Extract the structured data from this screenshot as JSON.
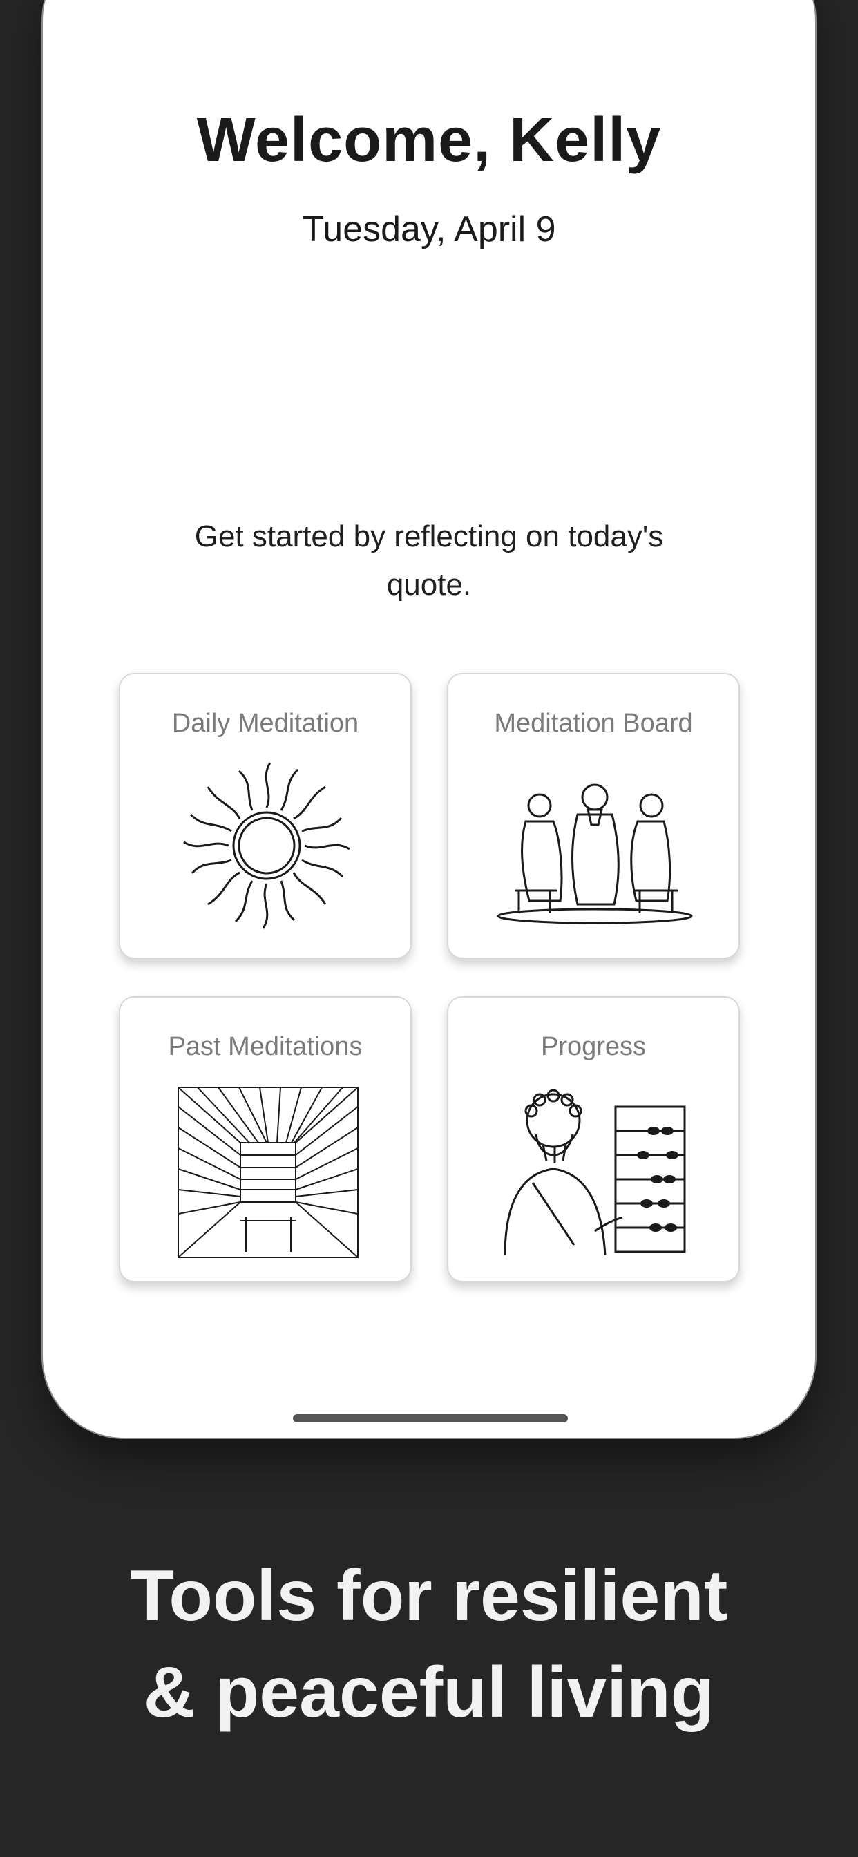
{
  "screen": {
    "greeting": "Welcome, Kelly",
    "date": "Tuesday, April 9",
    "prompt": "Get started by reflecting on today's quote."
  },
  "cards": [
    {
      "label": "Daily Meditation",
      "icon": "sun-illustration"
    },
    {
      "label": "Meditation Board",
      "icon": "three-philosophers-illustration"
    },
    {
      "label": "Past Meditations",
      "icon": "library-illustration"
    },
    {
      "label": "Progress",
      "icon": "philosopher-abacus-illustration"
    }
  ],
  "tagline": {
    "line1": "Tools for resilient",
    "line2": "& peaceful living"
  }
}
